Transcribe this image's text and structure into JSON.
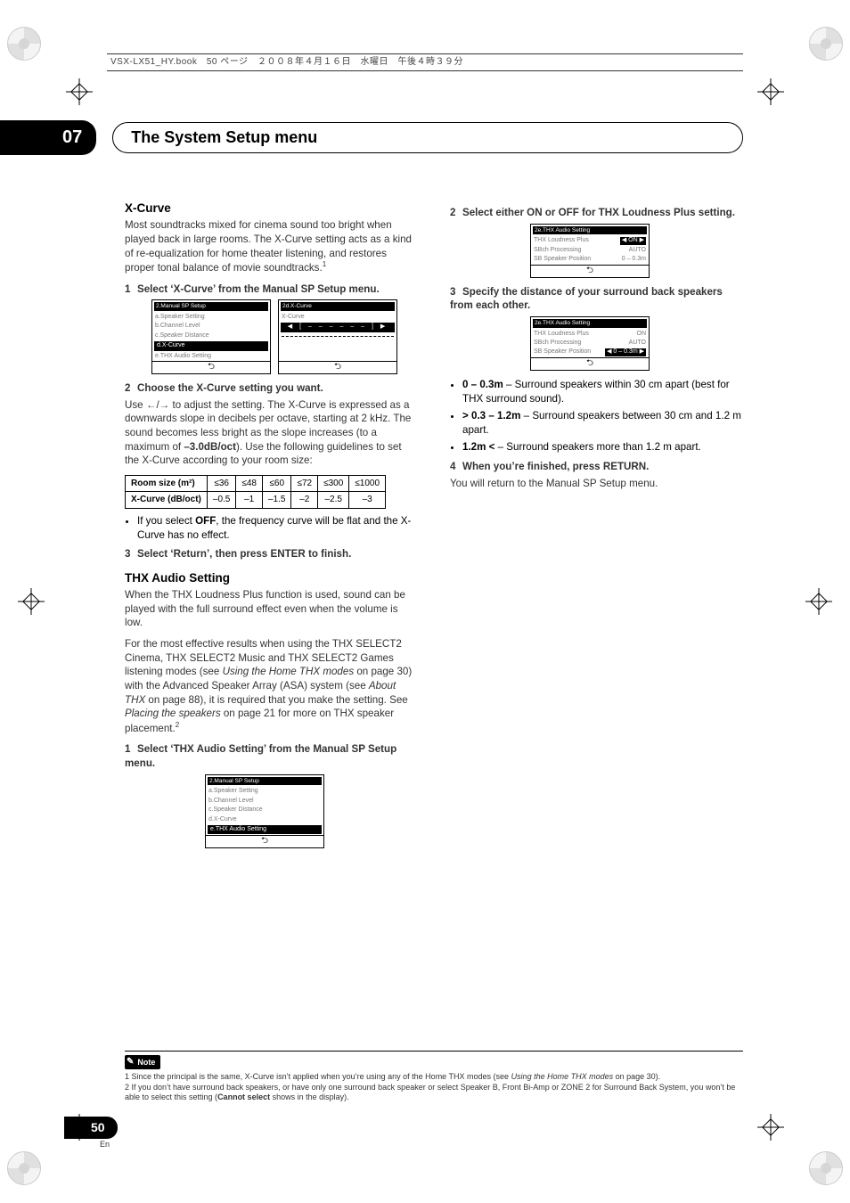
{
  "meta_header": "VSX-LX51_HY.book　50 ページ　２００８年４月１６日　水曜日　午後４時３９分",
  "chapter": {
    "num": "07",
    "title": "The System Setup menu"
  },
  "xcurve": {
    "heading": "X-Curve",
    "intro": "Most soundtracks mixed for cinema sound too bright when played back in large rooms. The X-Curve setting acts as a kind of re-equalization for home theater listening, and restores proper tonal balance of movie soundtracks.",
    "intro_sup": "1",
    "step1": "Select ‘X-Curve’ from the Manual SP Setup menu.",
    "ui_menu": {
      "title": "2.Manual SP Setup",
      "items": [
        "a.Speaker Setting",
        "b.Channel Level",
        "c.Speaker Distance",
        "d.X-Curve",
        "e.THX Audio Setting"
      ],
      "back": "⮌"
    },
    "ui_xcurve": {
      "title": "2d.X-Curve",
      "label": "X-Curve",
      "val": "◀  [ – – – – – – ]  ▶",
      "back": "⮌"
    },
    "step2": "Choose the X-Curve setting you want.",
    "step2_body_a": "Use ",
    "step2_arrows": "←/→",
    "step2_body_b": " to adjust the setting. The X-Curve is expressed as a downwards slope in decibels per octave, starting at 2 kHz. The sound becomes less bright as the slope increases (to a maximum of ",
    "step2_bold": "–3.0dB/oct",
    "step2_body_c": "). Use the following guidelines to set the X-Curve according to your room size:",
    "table": {
      "row1_label": "Room size (m²)",
      "row1": [
        "≤36",
        "≤48",
        "≤60",
        "≤72",
        "≤300",
        "≤1000"
      ],
      "row2_label": "X-Curve (dB/oct)",
      "row2": [
        "–0.5",
        "–1",
        "–1.5",
        "–2",
        "–2.5",
        "–3"
      ]
    },
    "bullet_off_a": "If you select ",
    "bullet_off_bold": "OFF",
    "bullet_off_b": ", the frequency curve will be flat and the X-Curve has no effect.",
    "step3": "Select ‘Return’, then press ENTER to finish."
  },
  "thx": {
    "heading": "THX Audio Setting",
    "intro1": "When the THX Loudness Plus function is used, sound can be played with the full surround effect even when the volume is low.",
    "intro2_a": "For the most effective results when using the THX SELECT2 Cinema, THX SELECT2 Music and THX SELECT2 Games listening modes (see ",
    "intro2_i1": "Using the Home THX modes",
    "intro2_b": " on page 30) with the Advanced Speaker Array (ASA) system (see ",
    "intro2_i2": "About THX",
    "intro2_c": " on page 88), it is required that you make the setting. See ",
    "intro2_i3": "Placing the speakers",
    "intro2_d": " on page 21 for more on THX speaker placement.",
    "intro2_sup": "2",
    "step1": "Select ‘THX Audio Setting’ from the Manual SP Setup menu.",
    "ui_menu": {
      "title": "2.Manual SP Setup",
      "items": [
        "a.Speaker Setting",
        "b.Channel Level",
        "c.Speaker Distance",
        "d.X-Curve",
        "e.THX Audio Setting"
      ],
      "back": "⮌"
    },
    "step2": "Select either ON or OFF for THX Loudness Plus setting.",
    "ui_loudness": {
      "title": "2e.THX Audio Setting",
      "row1_l": "THX Loudness Plus",
      "row1_v": "◀   ON   ▶",
      "row2_l": "SBch Processing",
      "row2_v": "AUTO",
      "row3_l": "SB Speaker Position",
      "row3_v": "0 – 0.3m",
      "back": "⮌"
    },
    "step3": "Specify the distance of your surround back speakers from each other.",
    "ui_dist": {
      "title": "2e.THX Audio Setting",
      "row1_l": "THX Loudness Plus",
      "row1_v": "ON",
      "row2_l": "SBch Processing",
      "row2_v": "AUTO",
      "row3_l": "SB Speaker Position",
      "row3_v": "◀ 0 – 0.3m ▶",
      "back": "⮌"
    },
    "bullets": [
      {
        "b": "0 – 0.3m",
        "t": " – Surround speakers within 30 cm apart (best for THX surround sound)."
      },
      {
        "b": "> 0.3 – 1.2m",
        "t": " – Surround speakers between 30 cm and 1.2 m apart."
      },
      {
        "b": "1.2m <",
        "t": " – Surround speakers more than 1.2 m apart."
      }
    ],
    "step4": "When you’re finished, press RETURN.",
    "step4_body": "You will return to the Manual SP Setup menu."
  },
  "note": {
    "label": "Note",
    "l1_a": "1 Since the principal is the same, X-Curve isn’t applied when you’re using any of the Home THX modes (see ",
    "l1_i": "Using the Home THX modes",
    "l1_b": " on page 30).",
    "l2_a": "2 If you don’t have surround back speakers, or have only one surround back speaker or select Speaker B, Front Bi-Amp or ZONE 2 for Surround Back System, you won’t be able to select this setting (",
    "l2_bold": "Cannot select",
    "l2_b": " shows in the display)."
  },
  "page": {
    "num": "50",
    "lang": "En"
  },
  "chart_data": {
    "type": "table",
    "title": "X-Curve vs Room size",
    "columns": [
      "Room size (m²)",
      "X-Curve (dB/oct)"
    ],
    "rows": [
      [
        "≤36",
        -0.5
      ],
      [
        "≤48",
        -1.0
      ],
      [
        "≤60",
        -1.5
      ],
      [
        "≤72",
        -2.0
      ],
      [
        "≤300",
        -2.5
      ],
      [
        "≤1000",
        -3.0
      ]
    ]
  }
}
